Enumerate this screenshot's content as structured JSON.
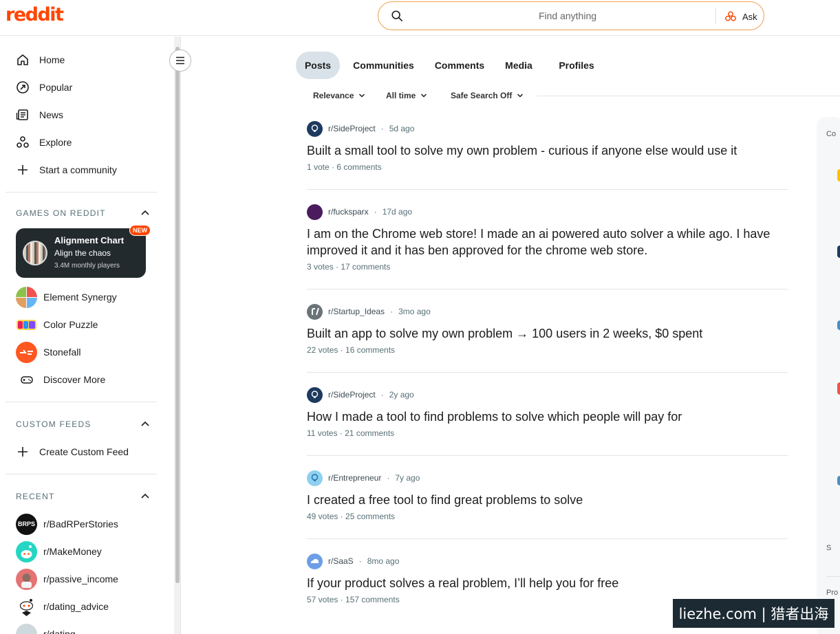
{
  "header": {
    "logo": "reddit",
    "search_placeholder": "Find anything",
    "ask_label": "Ask"
  },
  "sidebar": {
    "nav": [
      {
        "label": "Home",
        "icon": "home-icon"
      },
      {
        "label": "Popular",
        "icon": "popular-icon"
      },
      {
        "label": "News",
        "icon": "news-icon"
      },
      {
        "label": "Explore",
        "icon": "explore-icon"
      },
      {
        "label": "Start a community",
        "icon": "plus-icon"
      }
    ],
    "games_heading": "GAMES ON REDDIT",
    "featured_game": {
      "title": "Alignment Chart",
      "subtitle": "Align the chaos",
      "players": "3.4M monthly players",
      "badge": "NEW"
    },
    "games": [
      {
        "label": "Element Synergy"
      },
      {
        "label": "Color Puzzle"
      },
      {
        "label": "Stonefall"
      },
      {
        "label": "Discover More"
      }
    ],
    "custom_feeds_heading": "CUSTOM FEEDS",
    "create_feed": "Create Custom Feed",
    "recent_heading": "RECENT",
    "recent": [
      {
        "label": "r/BadRPerStories",
        "avatar_text": "BRPS"
      },
      {
        "label": "r/MakeMoney"
      },
      {
        "label": "r/passive_income"
      },
      {
        "label": "r/dating_advice"
      },
      {
        "label": "r/dating"
      }
    ]
  },
  "tabs": [
    {
      "label": "Posts",
      "active": true
    },
    {
      "label": "Communities"
    },
    {
      "label": "Comments"
    },
    {
      "label": "Media"
    },
    {
      "label": "Profiles"
    }
  ],
  "filters": [
    {
      "label": "Relevance"
    },
    {
      "label": "All time"
    },
    {
      "label": "Safe Search Off"
    }
  ],
  "posts": [
    {
      "subreddit": "r/SideProject",
      "age": "5d ago",
      "title": "Built a small tool to solve my own problem - curious if anyone else would use it",
      "stats": "1 vote · 6 comments"
    },
    {
      "subreddit": "r/fucksparx",
      "age": "17d ago",
      "title": "I am on the Chrome web store! I made an ai powered auto solver a while ago. I have improved it and it has ben approved for the chrome web store.",
      "stats": "3 votes · 17 comments"
    },
    {
      "subreddit": "r/Startup_Ideas",
      "age": "3mo ago",
      "title": "Built an app to solve my own problem → 100 users in 2 weeks, $0 spent",
      "stats": "22 votes · 16 comments"
    },
    {
      "subreddit": "r/SideProject",
      "age": "2y ago",
      "title": "How I made a tool to find problems to solve which people will pay for",
      "stats": "11 votes · 21 comments"
    },
    {
      "subreddit": "r/Entrepreneur",
      "age": "7y ago",
      "title": "I created a free tool to find great problems to solve",
      "stats": "49 votes · 25 comments"
    },
    {
      "subreddit": "r/SaaS",
      "age": "8mo ago",
      "title": "If your product solves a real problem, I’ll help you for free",
      "stats": "57 votes · 157 comments"
    }
  ],
  "right_panel": {
    "top_label": "Co",
    "mid_label": "S",
    "bottom_label": "Pro"
  },
  "watermark": "liezhe.com | 猎者出海",
  "colors": {
    "brand": "#ff4500",
    "active_tab": "#d9e2e8",
    "meta_text": "#576f76"
  }
}
